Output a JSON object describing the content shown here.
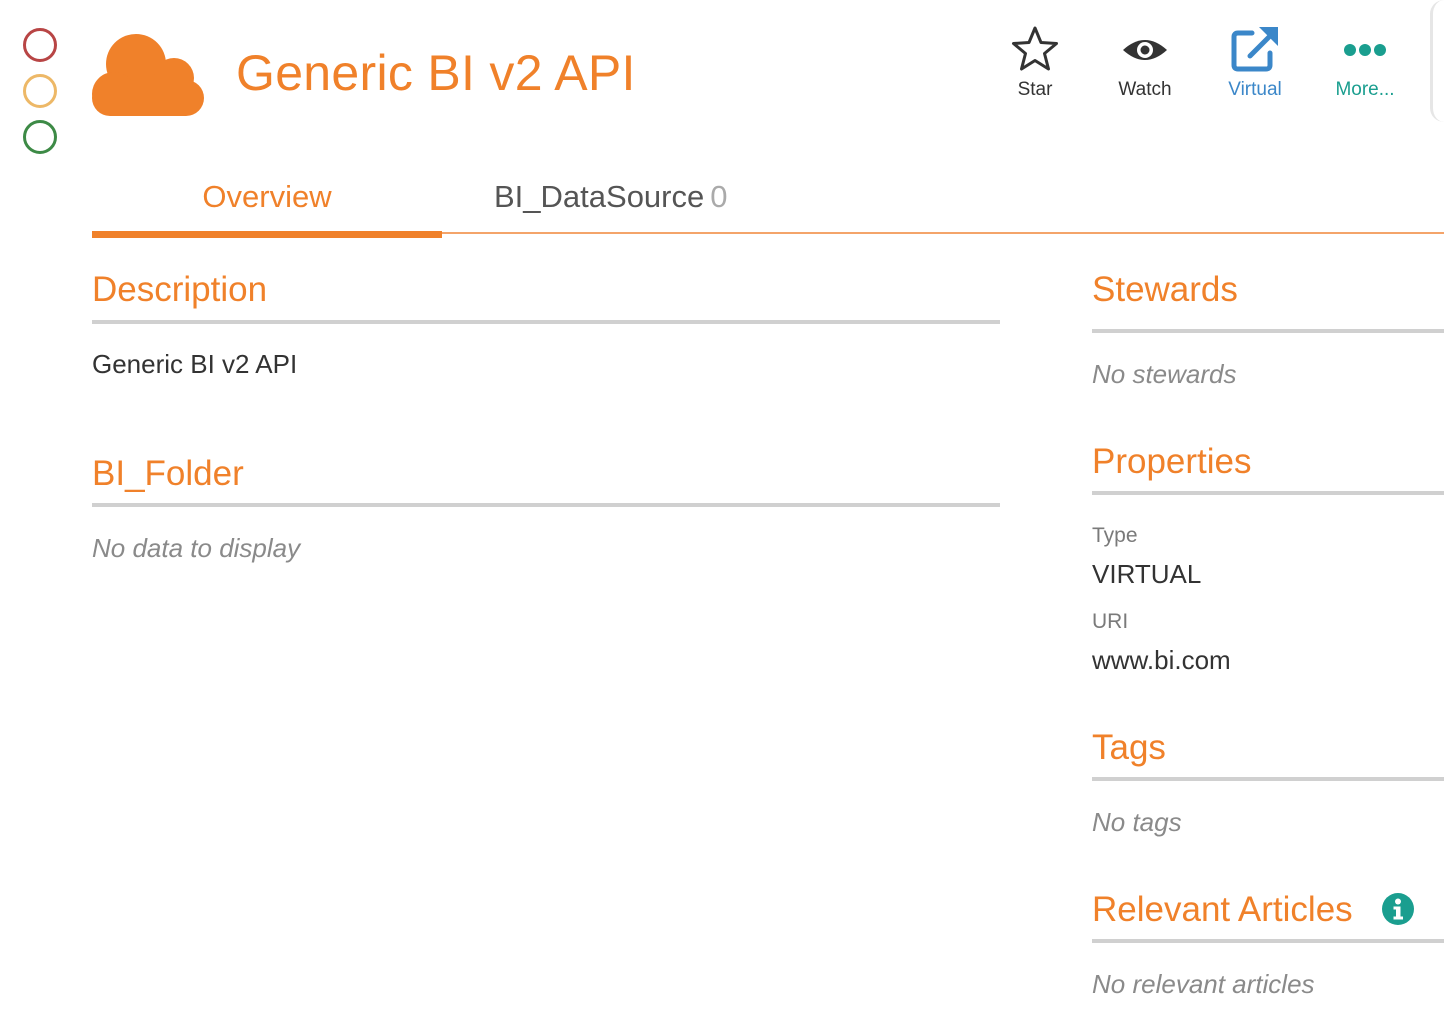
{
  "status_lights": [
    {
      "name": "red",
      "color": "#b84545"
    },
    {
      "name": "amber",
      "color": "#edb867"
    },
    {
      "name": "green",
      "color": "#3d8a46"
    }
  ],
  "header": {
    "logo_icon": "cloud-icon",
    "title": "Generic BI v2 API",
    "accent_color": "#f0812a"
  },
  "actions": {
    "star": {
      "label": "Star",
      "icon": "star-icon"
    },
    "watch": {
      "label": "Watch",
      "icon": "eye-icon"
    },
    "virtual": {
      "label": "Virtual",
      "icon": "external-link-icon",
      "color": "#3b87c9"
    },
    "more": {
      "label": "More...",
      "icon": "ellipsis-icon",
      "color": "#1a9e8f"
    }
  },
  "tabs": {
    "overview": {
      "label": "Overview",
      "active": true
    },
    "datasource": {
      "label": "BI_DataSource",
      "count": "0"
    }
  },
  "main": {
    "description": {
      "title": "Description",
      "text": "Generic BI v2 API"
    },
    "folder": {
      "title": "BI_Folder",
      "empty": "No data to display"
    }
  },
  "sidebar": {
    "stewards": {
      "title": "Stewards",
      "empty": "No stewards"
    },
    "properties": {
      "title": "Properties",
      "items": [
        {
          "label": "Type",
          "value": "VIRTUAL"
        },
        {
          "label": "URI",
          "value": "www.bi.com"
        }
      ]
    },
    "tags": {
      "title": "Tags",
      "empty": "No tags"
    },
    "articles": {
      "title": "Relevant Articles",
      "empty": "No relevant articles",
      "icon": "info-icon"
    }
  }
}
